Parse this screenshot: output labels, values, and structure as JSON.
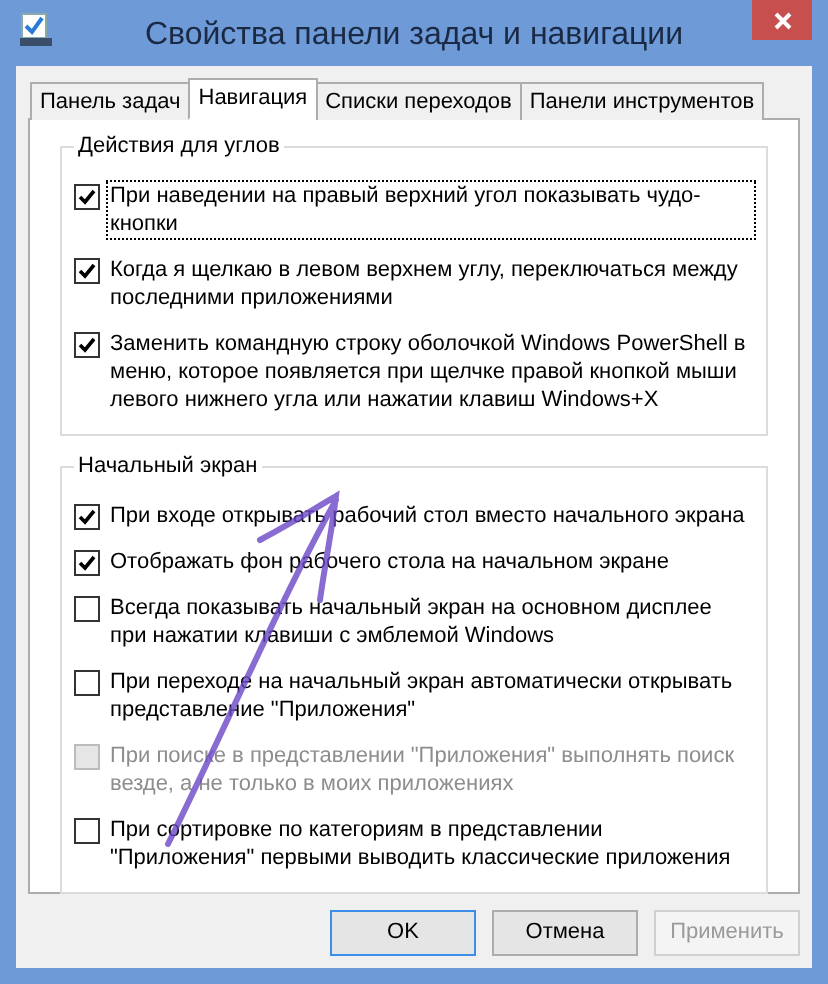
{
  "window": {
    "title": "Свойства панели задач и навигации"
  },
  "tabs": [
    {
      "label": "Панель задач",
      "selected": false
    },
    {
      "label": "Навигация",
      "selected": true
    },
    {
      "label": "Списки переходов",
      "selected": false
    },
    {
      "label": "Панели инструментов",
      "selected": false
    }
  ],
  "groups": [
    {
      "title": "Действия для углов",
      "items": [
        {
          "label": "При наведении на правый верхний угол показывать чудо-кнопки",
          "checked": true,
          "disabled": false,
          "focused": true
        },
        {
          "label": "Когда я щелкаю в левом верхнем углу, переключаться между последними приложениями",
          "checked": true,
          "disabled": false,
          "focused": false
        },
        {
          "label": "Заменить командную строку оболочкой Windows PowerShell в меню, которое появляется при щелчке правой кнопкой мыши левого нижнего угла или нажатии клавиш Windows+X",
          "checked": true,
          "disabled": false,
          "focused": false
        }
      ]
    },
    {
      "title": "Начальный экран",
      "items": [
        {
          "label": "При входе открывать рабочий стол вместо начального экрана",
          "checked": true,
          "disabled": false,
          "focused": false
        },
        {
          "label": "Отображать фон рабочего стола на начальном экране",
          "checked": true,
          "disabled": false,
          "focused": false
        },
        {
          "label": "Всегда показывать начальный экран на основном дисплее при нажатии клавиши с эмблемой Windows",
          "checked": false,
          "disabled": false,
          "focused": false
        },
        {
          "label": "При переходе на начальный экран автоматически открывать представление \"Приложения\"",
          "checked": false,
          "disabled": false,
          "focused": false
        },
        {
          "label": "При поиске в представлении \"Приложения\" выполнять поиск везде, а не только в моих приложениях",
          "checked": false,
          "disabled": true,
          "focused": false
        },
        {
          "label": "При сортировке по категориям в представлении \"Приложения\" первыми выводить классические приложения",
          "checked": false,
          "disabled": false,
          "focused": false
        }
      ]
    }
  ],
  "buttons": [
    {
      "label": "OK",
      "default": true,
      "disabled": false
    },
    {
      "label": "Отмена",
      "default": false,
      "disabled": false
    },
    {
      "label": "Применить",
      "default": false,
      "disabled": true
    }
  ]
}
